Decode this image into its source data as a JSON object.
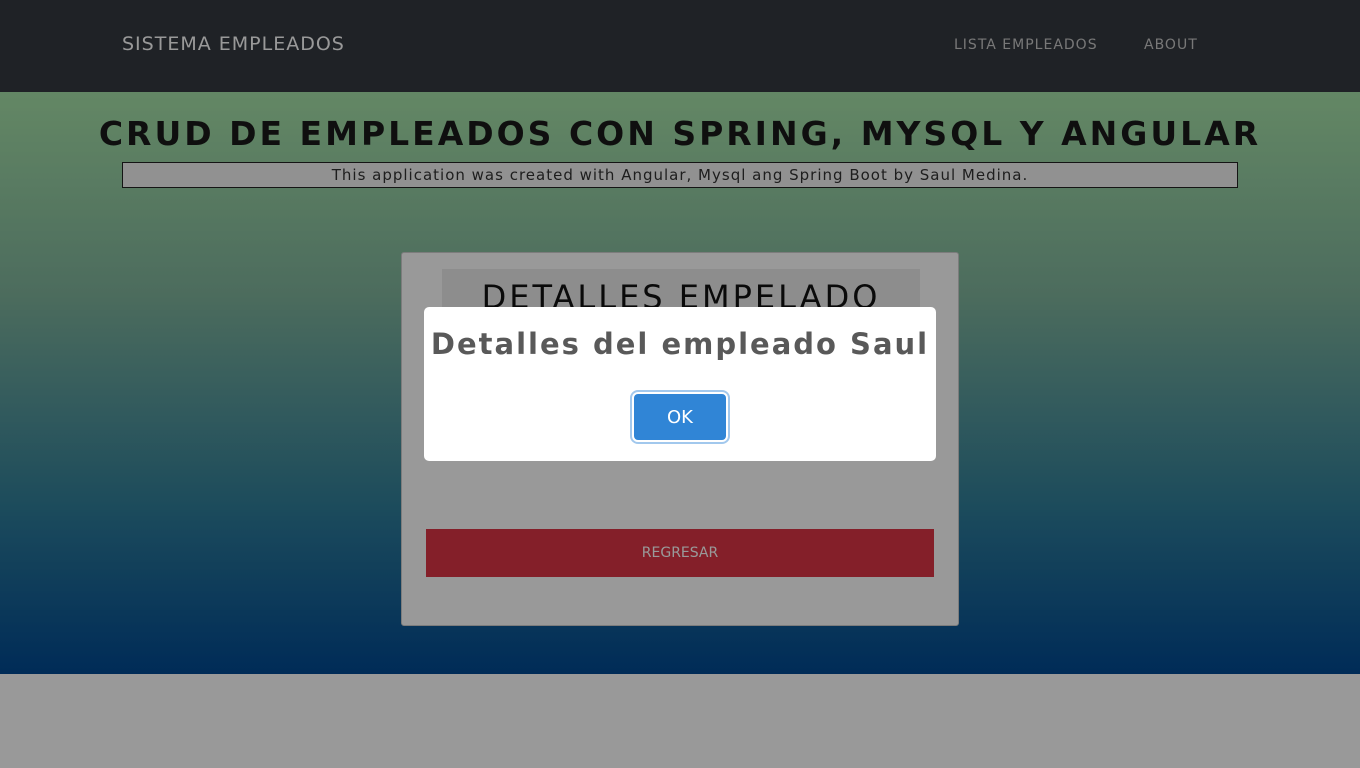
{
  "navbar": {
    "brand": "SISTEMA EMPLEADOS",
    "links": [
      "LISTA EMPLEADOS",
      "ABOUT"
    ]
  },
  "hero": {
    "title": "CRUD DE EMPLEADOS CON SPRING, MYSQL Y ANGULAR",
    "subtitle": "This application was created with Angular, Mysql ang Spring Boot by Saul Medina."
  },
  "card": {
    "header": "DETALLES EMPELADO",
    "back_button": "REGRESAR"
  },
  "modal": {
    "title": "Detalles del empleado Saul",
    "ok_button": "OK"
  },
  "colors": {
    "navbar": "#343a40",
    "danger": "#dc3545",
    "confirm": "#3085d6"
  }
}
